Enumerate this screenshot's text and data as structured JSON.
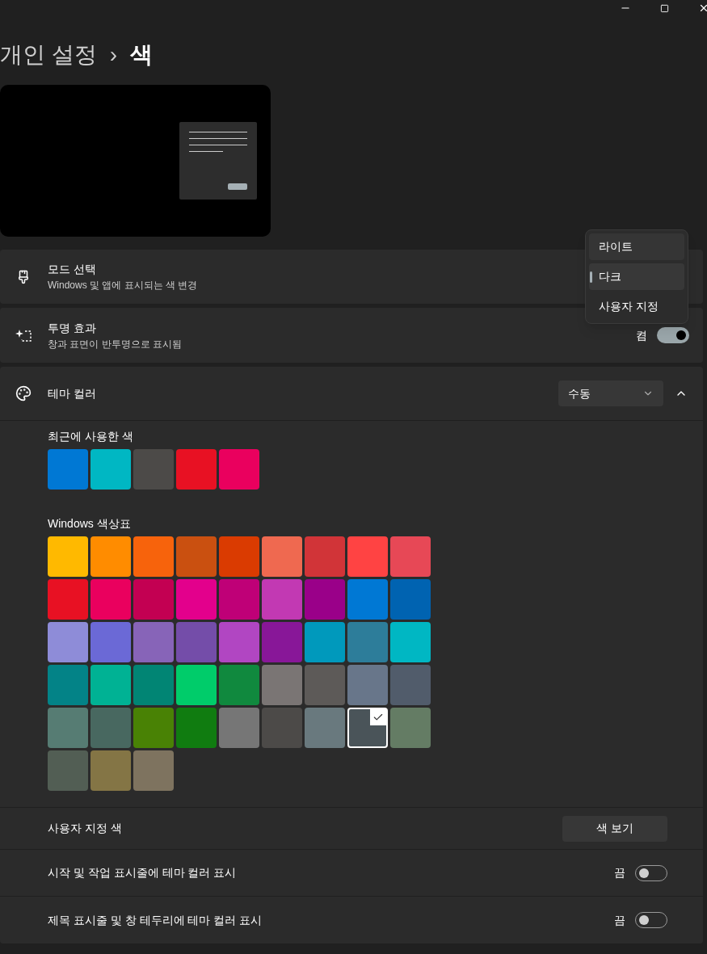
{
  "breadcrumb": {
    "parent": "개인 설정",
    "separator": "›",
    "current": "색"
  },
  "mode": {
    "title": "모드 선택",
    "subtitle": "Windows 및 앱에 표시되는 색 변경"
  },
  "mode_menu": [
    {
      "label": "라이트",
      "selected": false
    },
    {
      "label": "다크",
      "selected": true
    },
    {
      "label": "사용자 지정",
      "selected": false
    }
  ],
  "transparency": {
    "title": "투명 효과",
    "subtitle": "창과 표면이 반투명으로 표시됨",
    "state_label": "켬",
    "on": true
  },
  "theme_color": {
    "title": "테마 컬러",
    "dropdown": "수동",
    "expanded": true,
    "recent_label": "최근에 사용한 색",
    "recent": [
      {
        "color": "#0078d4",
        "selected": false
      },
      {
        "color": "#00b7c3",
        "selected": false
      },
      {
        "color": "#4c4a48",
        "selected": false
      },
      {
        "color": "#e81123",
        "selected": false
      },
      {
        "color": "#ea005e",
        "selected": false
      }
    ],
    "palette_label": "Windows 색상표",
    "palette": [
      {
        "color": "#ffb900",
        "selected": false
      },
      {
        "color": "#ff8c00",
        "selected": false
      },
      {
        "color": "#f7630c",
        "selected": false
      },
      {
        "color": "#ca5010",
        "selected": false
      },
      {
        "color": "#da3b01",
        "selected": false
      },
      {
        "color": "#ef6950",
        "selected": false
      },
      {
        "color": "#d13438",
        "selected": false
      },
      {
        "color": "#ff4343",
        "selected": false
      },
      {
        "color": "#e74856",
        "selected": false
      },
      {
        "color": "#e81123",
        "selected": false
      },
      {
        "color": "#ea005e",
        "selected": false
      },
      {
        "color": "#c30052",
        "selected": false
      },
      {
        "color": "#e3008c",
        "selected": false
      },
      {
        "color": "#bf0077",
        "selected": false
      },
      {
        "color": "#c239b3",
        "selected": false
      },
      {
        "color": "#9a0089",
        "selected": false
      },
      {
        "color": "#0078d4",
        "selected": false
      },
      {
        "color": "#0063b1",
        "selected": false
      },
      {
        "color": "#8e8cd8",
        "selected": false
      },
      {
        "color": "#6b69d6",
        "selected": false
      },
      {
        "color": "#8764b8",
        "selected": false
      },
      {
        "color": "#744da9",
        "selected": false
      },
      {
        "color": "#b146c2",
        "selected": false
      },
      {
        "color": "#881798",
        "selected": false
      },
      {
        "color": "#0099bc",
        "selected": false
      },
      {
        "color": "#2d7d9a",
        "selected": false
      },
      {
        "color": "#00b7c3",
        "selected": false
      },
      {
        "color": "#038387",
        "selected": false
      },
      {
        "color": "#00b294",
        "selected": false
      },
      {
        "color": "#018574",
        "selected": false
      },
      {
        "color": "#00cc6a",
        "selected": false
      },
      {
        "color": "#10893e",
        "selected": false
      },
      {
        "color": "#7a7574",
        "selected": false
      },
      {
        "color": "#5d5a58",
        "selected": false
      },
      {
        "color": "#68768a",
        "selected": false
      },
      {
        "color": "#515c6b",
        "selected": false
      },
      {
        "color": "#567c73",
        "selected": false
      },
      {
        "color": "#486860",
        "selected": false
      },
      {
        "color": "#498205",
        "selected": false
      },
      {
        "color": "#107c10",
        "selected": false
      },
      {
        "color": "#767676",
        "selected": false
      },
      {
        "color": "#4c4a48",
        "selected": false
      },
      {
        "color": "#69797e",
        "selected": false
      },
      {
        "color": "#4a5459",
        "selected": true
      },
      {
        "color": "#647c64",
        "selected": false
      },
      {
        "color": "#525e54",
        "selected": false
      },
      {
        "color": "#847545",
        "selected": false
      },
      {
        "color": "#7e735f",
        "selected": false
      }
    ],
    "custom_label": "사용자 지정 색",
    "custom_button": "색 보기"
  },
  "toggles": [
    {
      "label": "시작 및 작업 표시줄에 테마 컬러 표시",
      "state_label": "끔",
      "on": false
    },
    {
      "label": "제목 표시줄 및 창 테두리에 테마 컬러 표시",
      "state_label": "끔",
      "on": false
    }
  ]
}
